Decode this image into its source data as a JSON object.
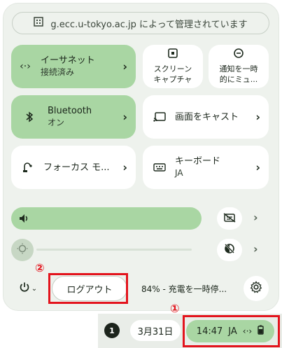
{
  "managed_notice": "g.ecc.u-tokyo.ac.jp によって管理されています",
  "tiles": {
    "ethernet": {
      "primary": "イーサネット",
      "secondary": "接続済み"
    },
    "bluetooth": {
      "primary": "Bluetooth",
      "secondary": "オン"
    },
    "focus": {
      "primary": "フォーカス モ..."
    },
    "cast": {
      "primary": "画面をキャスト"
    },
    "keyboard": {
      "primary": "キーボード",
      "secondary": "JA"
    },
    "screen_capture": {
      "line1": "スクリーン",
      "line2": "キャプチャ"
    },
    "notifications": {
      "line1": "通知を一時",
      "line2": "的にミュ..."
    }
  },
  "sliders": {
    "volume_level": 1.0,
    "brightness_level": 0.0
  },
  "bottom": {
    "logout_label": "ログアウト",
    "battery_status": "84% - 充電を一時停..."
  },
  "shelf": {
    "notification_count": "1",
    "date": "3月31日",
    "time": "14:47",
    "ime": "JA"
  },
  "annotations": {
    "marker1": "①",
    "marker2": "②"
  },
  "colors": {
    "accent_on": "#a9d6a3",
    "panel_bg": "#eef2ed",
    "highlight_red": "#e3141d"
  }
}
